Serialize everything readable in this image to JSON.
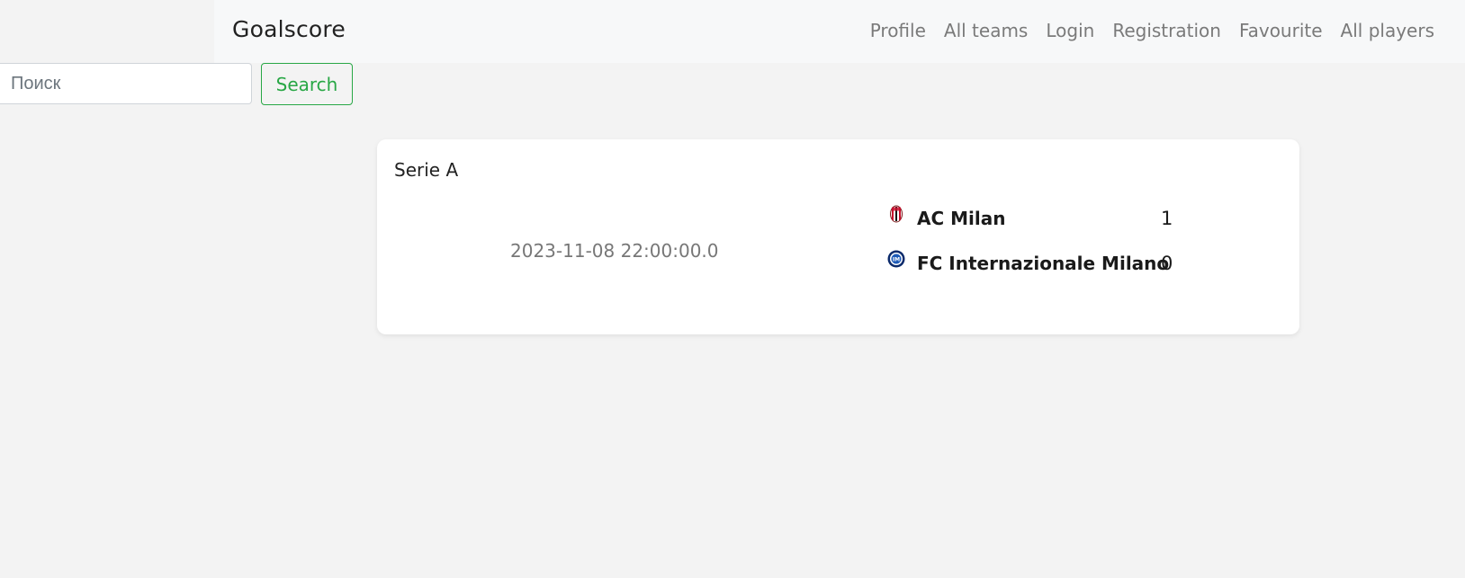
{
  "navbar": {
    "brand": "Goalscore",
    "links": [
      "Profile",
      "All teams",
      "Login",
      "Registration",
      "Favourite",
      "All players"
    ]
  },
  "search": {
    "placeholder": "Поиск",
    "value": "",
    "button_label": "Search"
  },
  "matches": [
    {
      "league": "Serie A",
      "date": "2023-11-08 22:00:00.0",
      "home": {
        "name": "AC Milan",
        "score": "1",
        "logo_icon": "ac-milan-crest-icon"
      },
      "away": {
        "name": "FC Internazionale Milano",
        "score": "0",
        "logo_icon": "inter-milan-crest-icon"
      }
    }
  ],
  "colors": {
    "accent_green": "#28a745",
    "page_background": "#f3f3f3",
    "navbar_background": "#f7f8f9"
  }
}
